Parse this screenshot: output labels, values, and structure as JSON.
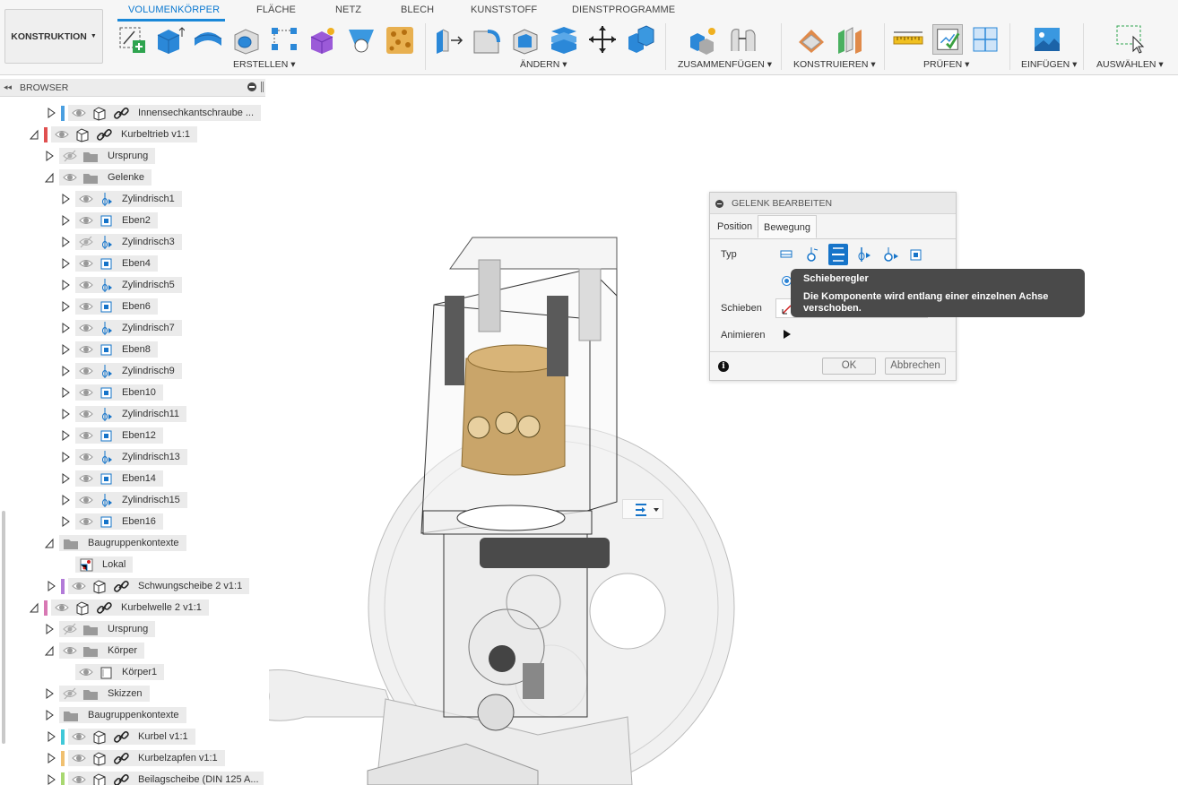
{
  "workspace": {
    "label": "KONSTRUKTION"
  },
  "tabs": [
    "VOLUMENKÖRPER",
    "FLÄCHE",
    "NETZ",
    "BLECH",
    "KUNSTSTOFF",
    "DIENSTPROGRAMME"
  ],
  "groups": {
    "erstellen": "ERSTELLEN",
    "aendern": "ÄNDERN",
    "zusammenfuegen": "ZUSAMMENFÜGEN",
    "konstruieren": "KONSTRUIEREN",
    "pruefen": "PRÜFEN",
    "einfuegen": "EINFÜGEN",
    "auswaehlen": "AUSWÄHLEN"
  },
  "browser": {
    "title": "BROWSER",
    "rows": [
      {
        "label": "Innensechkantschraube ...",
        "level": 0,
        "expanded": false,
        "color": "#4a9fe0",
        "link": true,
        "hidden": false
      },
      {
        "label": "Kurbeltrieb v1:1",
        "level": -1,
        "expanded": true,
        "color": "#e05050",
        "link": true,
        "hidden": false
      },
      {
        "label": "Ursprung",
        "level": 1,
        "expanded": false,
        "folder": true,
        "hidden": true
      },
      {
        "label": "Gelenke",
        "level": 1,
        "expanded": true,
        "folder": true,
        "hidden": false
      },
      {
        "label": "Zylindrisch1",
        "level": 2,
        "joint": "cyl",
        "hidden": false
      },
      {
        "label": "Eben2",
        "level": 2,
        "joint": "planar",
        "hidden": false
      },
      {
        "label": "Zylindrisch3",
        "level": 2,
        "joint": "cyl",
        "hidden": true
      },
      {
        "label": "Eben4",
        "level": 2,
        "joint": "planar",
        "hidden": false
      },
      {
        "label": "Zylindrisch5",
        "level": 2,
        "joint": "cyl",
        "hidden": false
      },
      {
        "label": "Eben6",
        "level": 2,
        "joint": "planar",
        "hidden": false
      },
      {
        "label": "Zylindrisch7",
        "level": 2,
        "joint": "cyl",
        "hidden": false
      },
      {
        "label": "Eben8",
        "level": 2,
        "joint": "planar",
        "hidden": false
      },
      {
        "label": "Zylindrisch9",
        "level": 2,
        "joint": "cyl",
        "hidden": false
      },
      {
        "label": "Eben10",
        "level": 2,
        "joint": "planar",
        "hidden": false
      },
      {
        "label": "Zylindrisch11",
        "level": 2,
        "joint": "cyl",
        "hidden": false
      },
      {
        "label": "Eben12",
        "level": 2,
        "joint": "planar",
        "hidden": false
      },
      {
        "label": "Zylindrisch13",
        "level": 2,
        "joint": "cyl",
        "hidden": false
      },
      {
        "label": "Eben14",
        "level": 2,
        "joint": "planar",
        "hidden": false
      },
      {
        "label": "Zylindrisch15",
        "level": 2,
        "joint": "cyl",
        "hidden": false
      },
      {
        "label": "Eben16",
        "level": 2,
        "joint": "planar",
        "hidden": false
      },
      {
        "label": "Baugruppenkontexte",
        "level": 1,
        "expanded": true,
        "folder": true,
        "noeye": true
      },
      {
        "label": "Lokal",
        "level": 2,
        "context": true,
        "noexp": true,
        "noeye": true
      },
      {
        "label": "Schwungscheibe 2 v1:1",
        "level": 0,
        "expanded": false,
        "color": "#b27ad8",
        "link": true,
        "hidden": false
      },
      {
        "label": "Kurbelwelle 2 v1:1",
        "level": -1,
        "expanded": true,
        "color": "#d878b4",
        "link": true,
        "hidden": false
      },
      {
        "label": "Ursprung",
        "level": 1,
        "expanded": false,
        "folder": true,
        "hidden": true
      },
      {
        "label": "Körper",
        "level": 1,
        "expanded": true,
        "folder": true,
        "hidden": false
      },
      {
        "label": "Körper1",
        "level": 2,
        "body": true,
        "noexp": true,
        "hidden": false
      },
      {
        "label": "Skizzen",
        "level": 1,
        "expanded": false,
        "folder": true,
        "hidden": true
      },
      {
        "label": "Baugruppenkontexte",
        "level": 1,
        "expanded": false,
        "folder": true,
        "noeye": true
      },
      {
        "label": "Kurbel v1:1",
        "level": 0,
        "expanded": false,
        "color": "#40c8d8",
        "link": true,
        "hidden": false
      },
      {
        "label": "Kurbelzapfen v1:1",
        "level": 0,
        "expanded": false,
        "color": "#f0c070",
        "link": true,
        "hidden": false
      },
      {
        "label": "Beilagscheibe (DIN 125 A...",
        "level": 0,
        "expanded": false,
        "color": "#a8d870",
        "link": true,
        "hidden": false
      }
    ]
  },
  "dialog": {
    "title": "GELENK BEARBEITEN",
    "tabs": [
      "Position",
      "Bewegung"
    ],
    "type_label": "Typ",
    "slide_label": "Schieben",
    "animate_label": "Animieren",
    "ok_label": "OK",
    "cancel_label": "Abbrechen"
  },
  "tooltip": {
    "title": "Schieberegler",
    "body": "Die Komponente wird entlang einer einzelnen Achse verschoben."
  },
  "colors": {
    "accent": "#1674c9",
    "tab_active": "#0a78d0"
  }
}
